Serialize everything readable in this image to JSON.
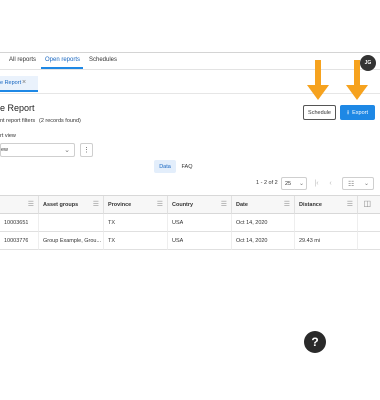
{
  "nav": {
    "tabs": [
      "All reports",
      "Open reports",
      "Schedules"
    ],
    "active_tab": "Open reports",
    "user_initials": "JG"
  },
  "doc_tab": {
    "label": "e Report",
    "close_glyph": "×"
  },
  "report": {
    "title": "e Report",
    "filters_text": "nt report filters",
    "records_found": "(2 records found)",
    "view_label": "rt view",
    "view_value": "ew"
  },
  "actions": {
    "schedule_label": "Schedule",
    "export_label": "Export"
  },
  "segments": {
    "data_label": "Data",
    "faq_label": "FAQ"
  },
  "pagination": {
    "label": "1 - 2 of 2",
    "page_size": "25"
  },
  "table": {
    "columns": [
      "",
      "Asset groups",
      "Province",
      "Country",
      "Date",
      "Distance"
    ],
    "rows": [
      [
        "10003651",
        "",
        "TX",
        "USA",
        "Oct 14, 2020",
        ""
      ],
      [
        "10003776",
        "Group Example, Grou...",
        "TX",
        "USA",
        "Oct 14, 2020",
        "29.43 mi"
      ]
    ]
  },
  "help_glyph": "?",
  "colors": {
    "accent": "#1e88e5",
    "annotation_arrow": "#f6a21e"
  }
}
